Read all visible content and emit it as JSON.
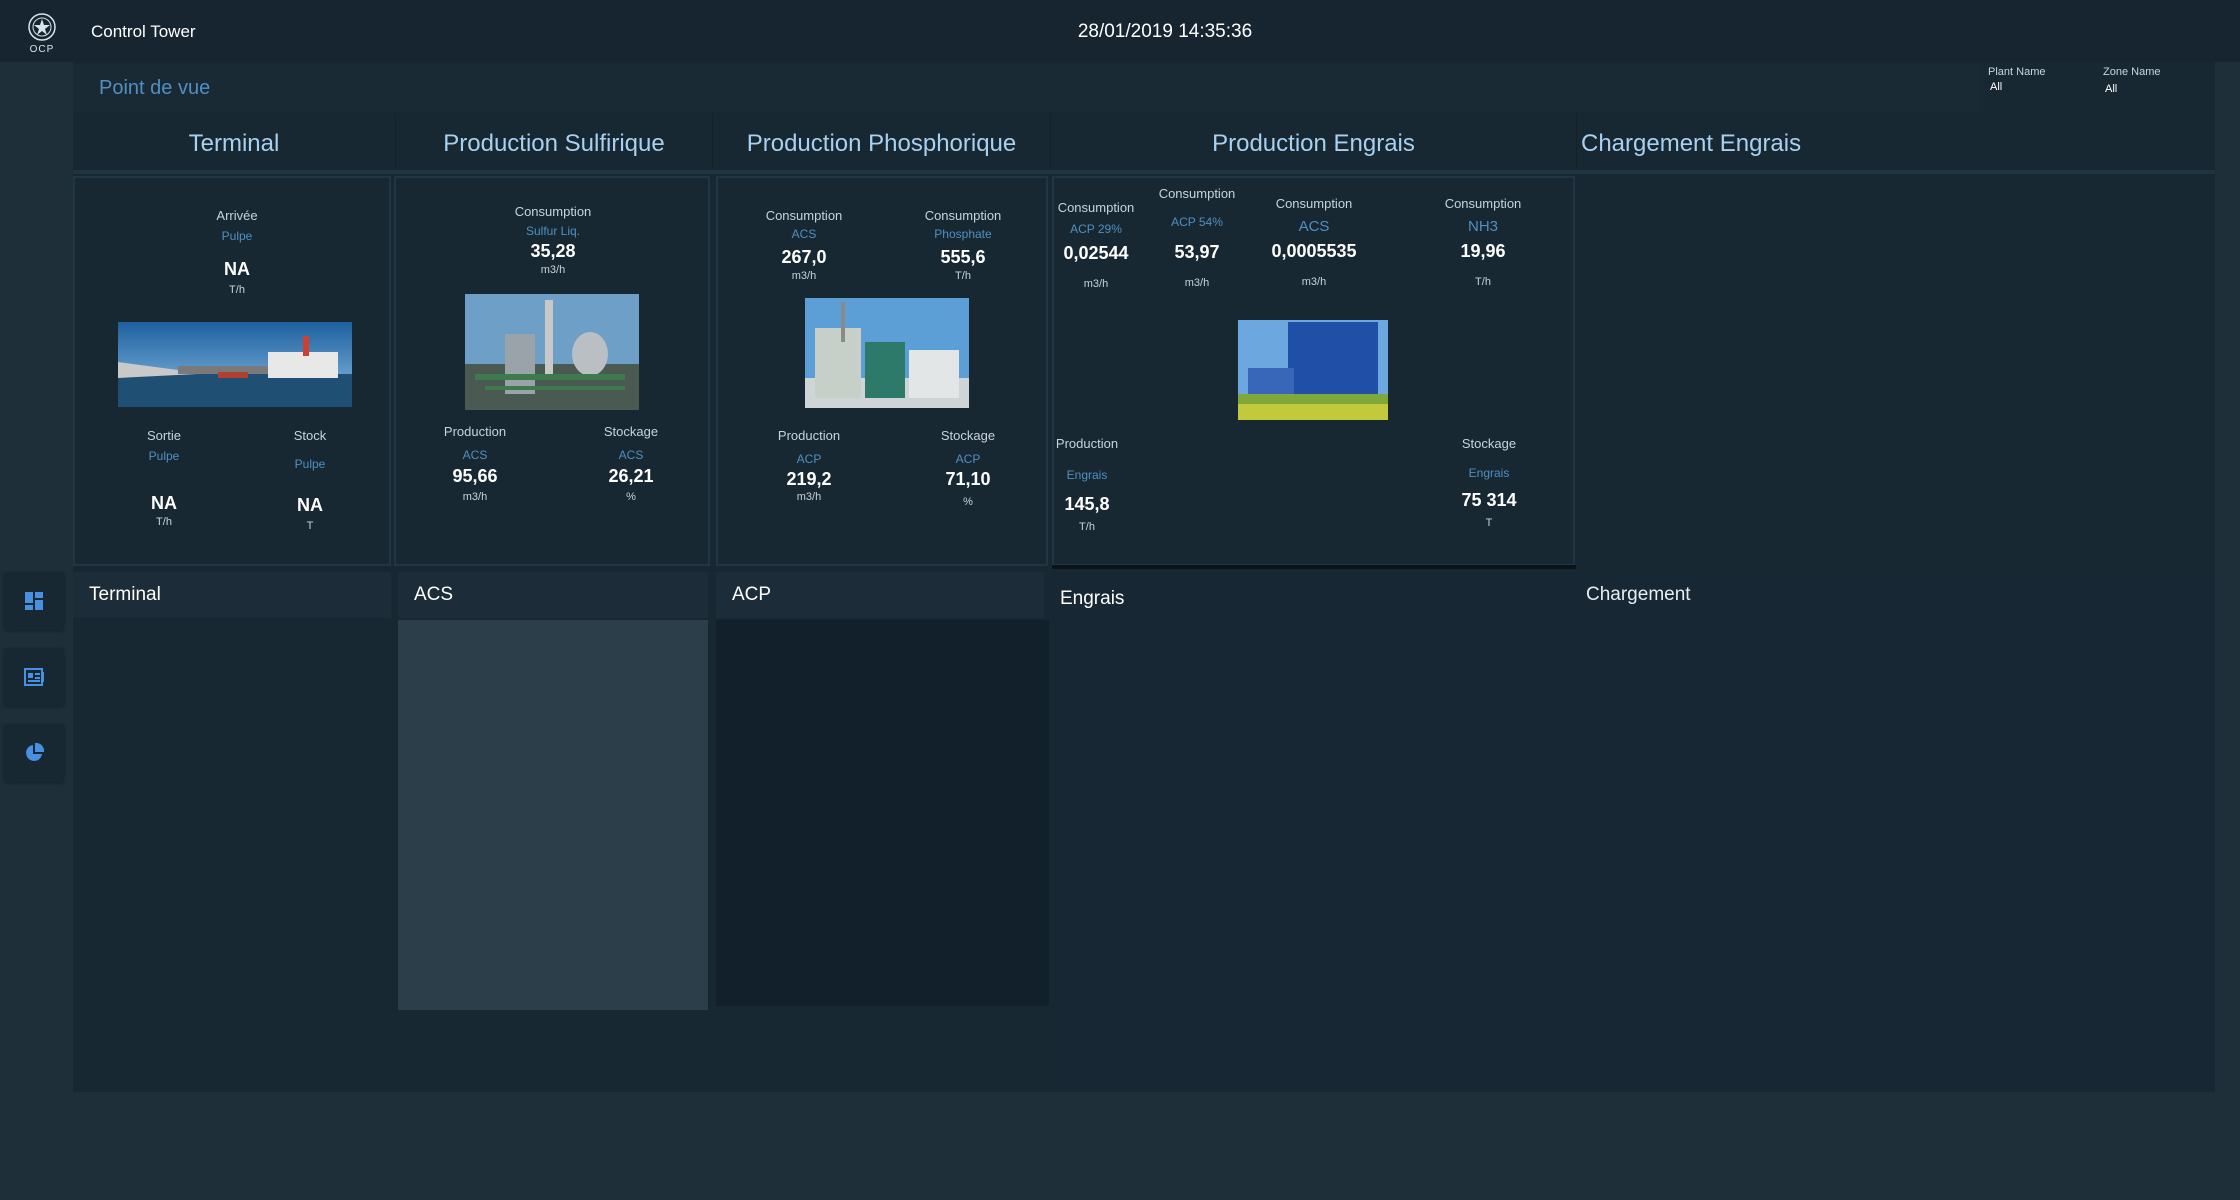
{
  "app": {
    "title": "Control Tower",
    "logo_text": "OCP",
    "datetime": "28/01/2019 14:35:36"
  },
  "pov": {
    "title": "Point de vue"
  },
  "filters": [
    {
      "label": "Plant Name",
      "value": "All"
    },
    {
      "label": "Zone Name",
      "value": "All"
    }
  ],
  "nav": {
    "icons": [
      "dashboard-icon",
      "report-icon",
      "pie-chart-icon"
    ]
  },
  "columns": {
    "terminal": "Terminal",
    "sulfurique": "Production Sulfirique",
    "phosphorique": "Production Phosphorique",
    "engrais": "Production Engrais",
    "chargement": "Chargement Engrais"
  },
  "terminal": {
    "arrivee": {
      "label": "Arrivée",
      "sub": "Pulpe",
      "value": "NA",
      "unit": "T/h"
    },
    "sortie": {
      "label": "Sortie",
      "sub": "Pulpe",
      "value": "NA",
      "unit": "T/h"
    },
    "stock": {
      "label": "Stock",
      "sub": "Pulpe",
      "value": "NA",
      "unit": "T"
    }
  },
  "sulfurique": {
    "consumption": {
      "label": "Consumption",
      "sub": "Sulfur Liq.",
      "value": "35,28",
      "unit": "m3/h"
    },
    "production": {
      "label": "Production",
      "sub": "ACS",
      "value": "95,66",
      "unit": "m3/h"
    },
    "stockage": {
      "label": "Stockage",
      "sub": "ACS",
      "value": "26,21",
      "unit": "%"
    }
  },
  "phosphorique": {
    "cons_acs": {
      "label": "Consumption",
      "sub": "ACS",
      "value": "267,0",
      "unit": "m3/h"
    },
    "cons_phosphate": {
      "label": "Consumption",
      "sub": "Phosphate",
      "value": "555,6",
      "unit": "T/h"
    },
    "production": {
      "label": "Production",
      "sub": "ACP",
      "value": "219,2",
      "unit": "m3/h"
    },
    "stockage": {
      "label": "Stockage",
      "sub": "ACP",
      "value": "71,10",
      "unit": "%"
    }
  },
  "engrais": {
    "cons_acp29": {
      "label": "Consumption",
      "sub": "ACP 29%",
      "value": "0,02544",
      "unit": "m3/h"
    },
    "cons_acp54": {
      "label": "Consumption",
      "sub": "ACP 54%",
      "value": "53,97",
      "unit": "m3/h"
    },
    "cons_acs": {
      "label": "Consumption",
      "sub": "ACS",
      "value": "0,0005535",
      "unit": "m3/h"
    },
    "cons_nh3": {
      "label": "Consumption",
      "sub": "NH3",
      "value": "19,96",
      "unit": "T/h"
    },
    "production": {
      "label": "Production",
      "sub": "Engrais",
      "value": "145,8",
      "unit": "T/h"
    },
    "stockage": {
      "label": "Stockage",
      "sub": "Engrais",
      "value": "75 314",
      "unit": "T"
    }
  },
  "sections": {
    "terminal": "Terminal",
    "acs": "ACS",
    "acp": "ACP",
    "engrais": "Engrais",
    "chargement": "Chargement"
  }
}
